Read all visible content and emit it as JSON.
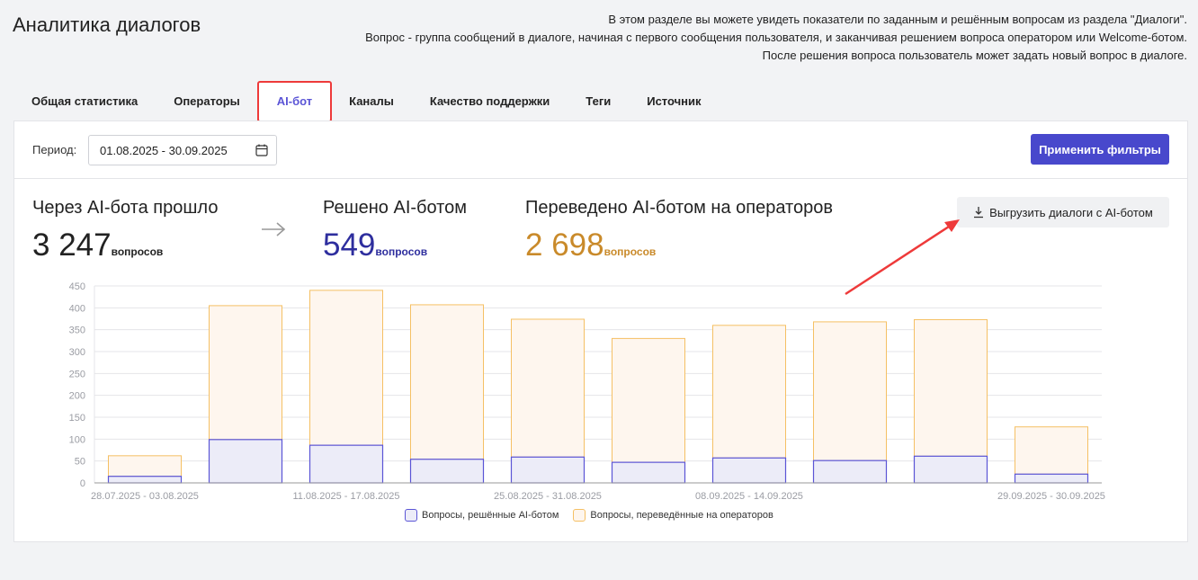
{
  "header": {
    "title": "Аналитика диалогов",
    "description": [
      "В этом разделе вы можете увидеть показатели по заданным и решённым вопросам из раздела \"Диалоги\".",
      "Вопрос - группа сообщений в диалоге, начиная с первого сообщения пользователя, и заканчивая решением вопроса оператором или Welcome-ботом.",
      "После решения вопроса пользователь может задать новый вопрос в диалоге."
    ]
  },
  "tabs": [
    {
      "label": "Общая статистика"
    },
    {
      "label": "Операторы"
    },
    {
      "label": "AI-бот",
      "active": true
    },
    {
      "label": "Каналы"
    },
    {
      "label": "Качество поддержки"
    },
    {
      "label": "Теги"
    },
    {
      "label": "Источник"
    }
  ],
  "filters": {
    "period_label": "Период:",
    "period_value": "01.08.2025 - 30.09.2025",
    "apply_label": "Применить фильтры"
  },
  "stats": {
    "total": {
      "label": "Через AI-бота прошло",
      "value": "3 247",
      "unit": "вопросов"
    },
    "resolved": {
      "label": "Решено AI-ботом",
      "value": "549",
      "unit": "вопросов"
    },
    "transferred": {
      "label": "Переведено AI-ботом на операторов",
      "value": "2 698",
      "unit": "вопросов"
    },
    "export_label": "Выгрузить диалоги с AI-ботом"
  },
  "colors": {
    "accent": "#4848cc",
    "resolved_value": "#2e2e9e",
    "transferred_value": "#c98a2a",
    "resolved_stroke": "#5b55d6",
    "resolved_fill": "#ececf8",
    "transferred_stroke": "#f5c064",
    "transferred_fill": "#fef6ee"
  },
  "chart_data": {
    "type": "bar",
    "stacked": true,
    "categories": [
      "28.07.2025 - 03.08.2025",
      "",
      "11.08.2025 - 17.08.2025",
      "",
      "25.08.2025 - 31.08.2025",
      "",
      "08.09.2025 - 14.09.2025",
      "",
      "",
      "29.09.2025 - 30.09.2025"
    ],
    "series": [
      {
        "name": "Вопросы, решённые AI-ботом",
        "values": [
          15,
          99,
          86,
          54,
          59,
          47,
          57,
          51,
          61,
          20
        ]
      },
      {
        "name": "Вопросы, переведённые на операторов",
        "values": [
          47,
          306,
          354,
          353,
          315,
          283,
          303,
          317,
          312,
          108
        ]
      }
    ],
    "ylim": [
      0,
      450
    ],
    "yticks": [
      "0",
      "50",
      "100",
      "150",
      "200",
      "250",
      "300",
      "350",
      "400",
      "450"
    ],
    "grid": true,
    "legend": "bottom-center"
  }
}
